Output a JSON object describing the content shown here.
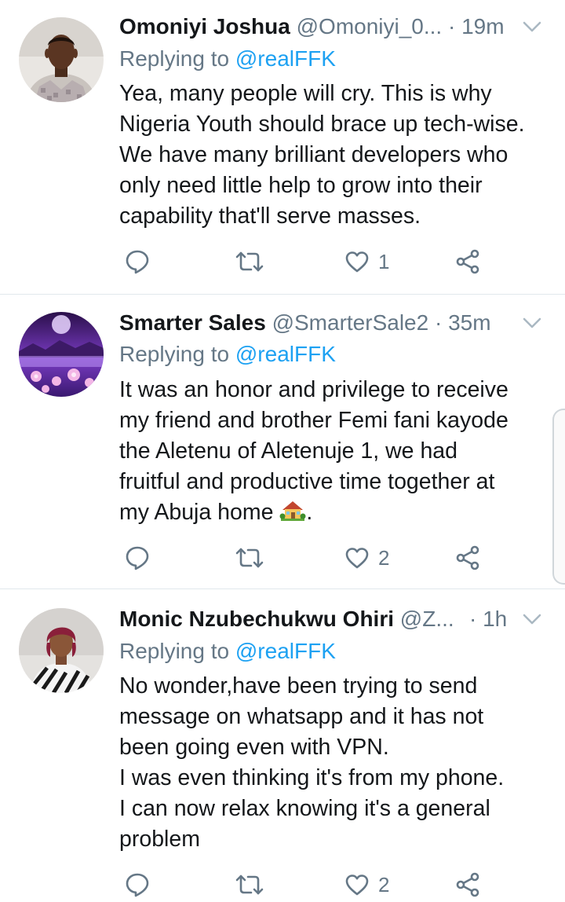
{
  "tweets": [
    {
      "name": "Omoniyi Joshua",
      "handle": "@Omoniyi_0...",
      "dot": "·",
      "time": "19m",
      "replying_prefix": "Replying to",
      "replying_to": "@realFFK",
      "text": "Yea, many people will cry. This is why\nNigeria Youth should brace up tech-wise.\nWe have many brilliant developers who\nonly need little help to grow into their\ncapability that'll serve masses.",
      "like_count": "1"
    },
    {
      "name": "Smarter Sales",
      "handle": "@SmarterSale2",
      "dot": "·",
      "time": "35m",
      "replying_prefix": "Replying to",
      "replying_to": "@realFFK",
      "text": "It was an honor and privilege to receive\nmy friend and brother Femi fani kayode\nthe Aletenu of Aletenuje 1, we had\nfruitful and productive time together at\nmy Abuja home",
      "text_suffix": ".",
      "emoji": "house-with-garden-icon",
      "like_count": "2"
    },
    {
      "name": "Monic Nzubechukwu Ohiri",
      "handle": "@Z...",
      "dot": "·",
      "time": "1h",
      "replying_prefix": "Replying to",
      "replying_to": "@realFFK",
      "text": "No wonder,have been trying to send\nmessage on whatsapp and it has not\nbeen going even with VPN.\nI was even thinking it's from my phone.\nI can now relax knowing it's a general\nproblem",
      "like_count": "2"
    }
  ],
  "colors": {
    "text": "#14171a",
    "muted": "#657786",
    "link": "#1da1f2",
    "divider": "#e1e8ed"
  },
  "icons": [
    "reply-icon",
    "retweet-icon",
    "like-icon",
    "share-icon",
    "chevron-down-icon"
  ]
}
